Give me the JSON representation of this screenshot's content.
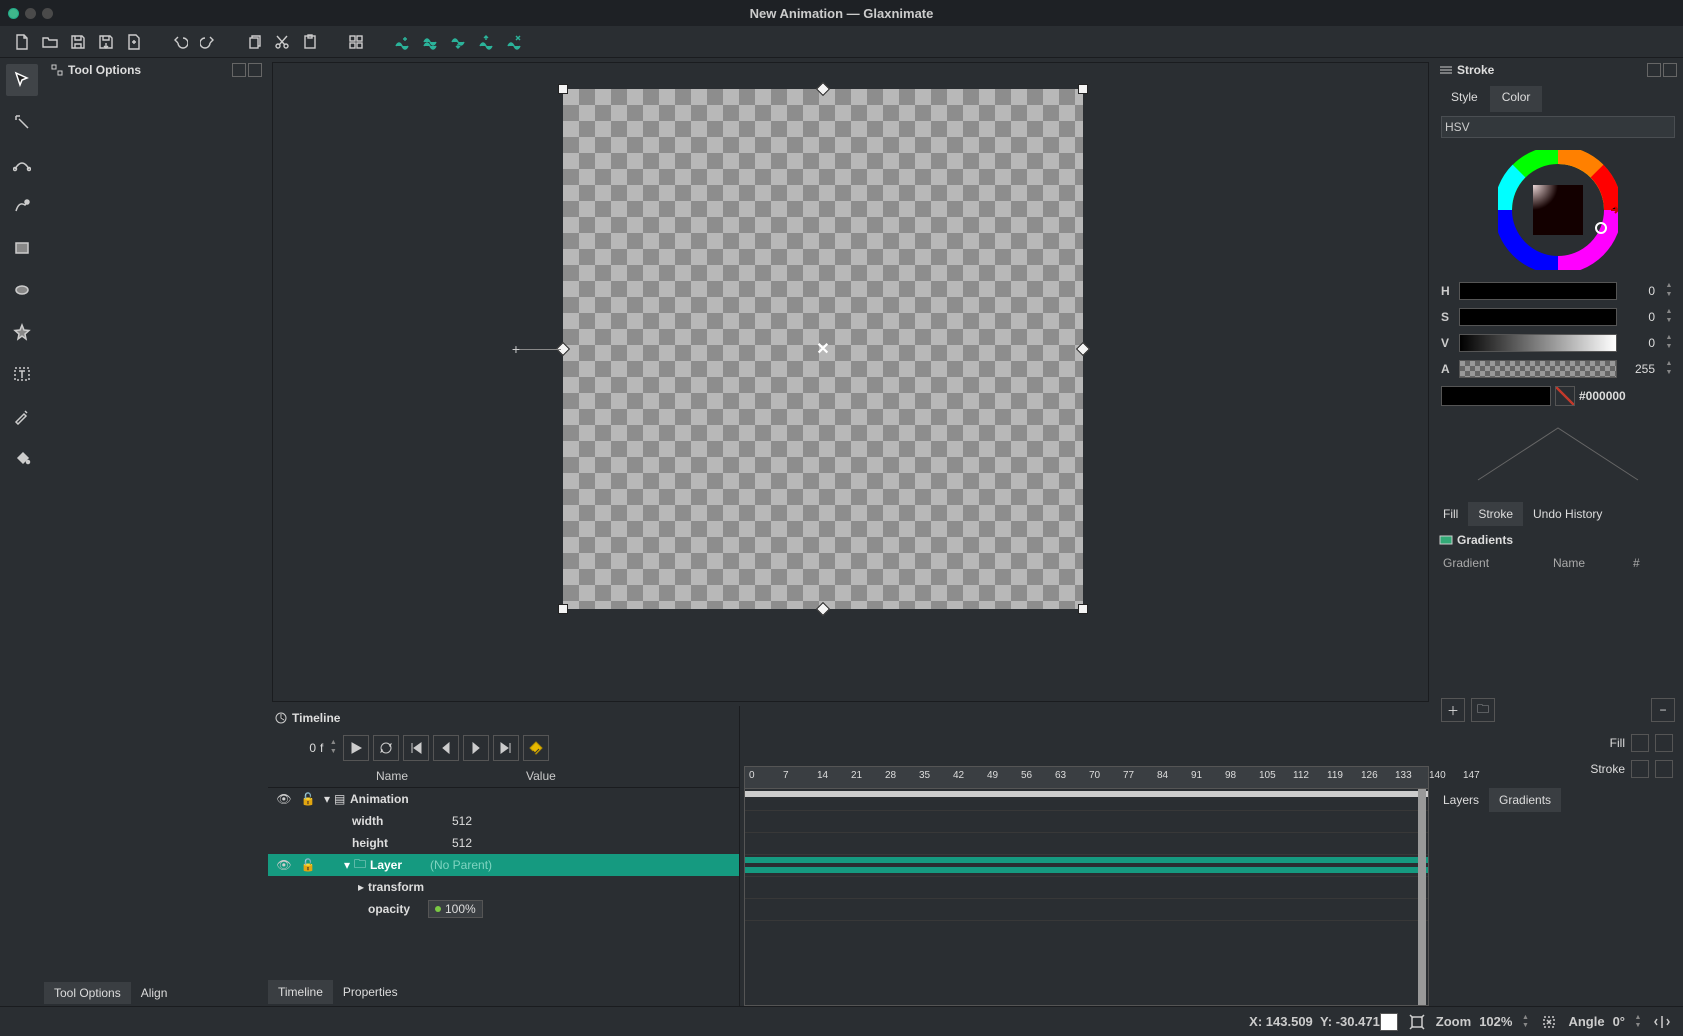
{
  "window": {
    "title": "New Animation — Glaxnimate"
  },
  "panels": {
    "tool_options": "Tool Options",
    "align": "Align",
    "stroke": "Stroke",
    "fill": "Fill",
    "stroke_tab": "Stroke",
    "undo_history": "Undo History",
    "timeline": "Timeline",
    "properties": "Properties",
    "gradients": "Gradients",
    "layers": "Layers"
  },
  "stroke_panel": {
    "style_tab": "Style",
    "color_tab": "Color",
    "mode": "HSV",
    "h_label": "H",
    "h_val": "0",
    "s_label": "S",
    "s_val": "0",
    "v_label": "V",
    "v_val": "0",
    "a_label": "A",
    "a_val": "255",
    "hex": "#000000"
  },
  "gradients_panel": {
    "col_gradient": "Gradient",
    "col_name": "Name",
    "col_count": "#",
    "fill_label": "Fill",
    "stroke_label": "Stroke"
  },
  "timeline_panel": {
    "frame": "0",
    "frame_suffix": "f",
    "col_name": "Name",
    "col_value": "Value",
    "rows": {
      "animation": "Animation",
      "width": "width",
      "width_v": "512",
      "height": "height",
      "height_v": "512",
      "layer": "Layer",
      "layer_v": "(No Parent)",
      "transform": "transform",
      "opacity": "opacity",
      "opacity_v": "100%"
    },
    "ruler": [
      "0",
      "7",
      "14",
      "21",
      "28",
      "35",
      "42",
      "49",
      "56",
      "63",
      "70",
      "77",
      "84",
      "91",
      "98",
      "105",
      "112",
      "119",
      "126",
      "133",
      "140",
      "147"
    ]
  },
  "statusbar": {
    "x_label": "X:",
    "x_val": "143.509",
    "y_label": "Y:",
    "y_val": "-30.471",
    "zoom_label": "Zoom",
    "zoom_val": "102%",
    "angle_label": "Angle",
    "angle_val": "0°"
  }
}
